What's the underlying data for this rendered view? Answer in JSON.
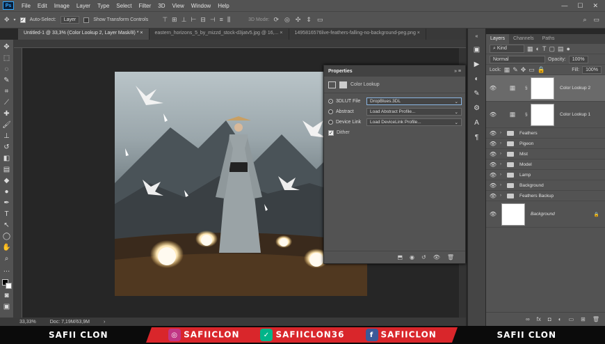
{
  "app": {
    "logo": "Ps"
  },
  "menu": [
    "File",
    "Edit",
    "Image",
    "Layer",
    "Type",
    "Select",
    "Filter",
    "3D",
    "View",
    "Window",
    "Help"
  ],
  "window_controls": {
    "minimize": "—",
    "maximize": "☐",
    "close": "✕"
  },
  "options_bar": {
    "auto_select_label": "Auto-Select:",
    "auto_select_value": "Layer",
    "transform_label": "Show Transform Controls",
    "mode_3d": "3D Mode:"
  },
  "tabs": [
    {
      "label": "Untitled-1 @ 33,3% (Color Lookup 2, Layer Mask/8) *",
      "close": "×"
    },
    {
      "label": "eastern_horizons_5_by_mizzd_stock-d3jatv5.jpg @ 16,...",
      "close": "×"
    },
    {
      "label": "1495816576live-feathers-falling-no-background-peg.png",
      "close": "×"
    }
  ],
  "status": {
    "zoom": "33,33%",
    "doc": "Doc: 7,19M/63,9M",
    "arrow": "›"
  },
  "properties": {
    "title": "Properties",
    "adjustment_name": "Color Lookup",
    "rows": [
      {
        "label": "3DLUT File",
        "value": "DropBlues.3DL"
      },
      {
        "label": "Abstract",
        "value": "Load Abstract Profile..."
      },
      {
        "label": "Device Link",
        "value": "Load DeviceLink Profile..."
      }
    ],
    "dither": "Dither"
  },
  "layers_panel": {
    "tabs": [
      "Layers",
      "Channels",
      "Paths"
    ],
    "filter": "Kind",
    "blend_mode": "Normal",
    "opacity_label": "Opacity:",
    "opacity": "100%",
    "lock_label": "Lock:",
    "fill_label": "Fill:",
    "fill": "100%",
    "adjustment_layers": [
      "Color Lookup 2",
      "Color Lookup 1"
    ],
    "groups": [
      "Feathers",
      "Pigeon",
      "Mist",
      "Model",
      "Lamp",
      "Background",
      "Feathers Backup"
    ],
    "background_layer": "Background"
  },
  "banner": {
    "left": "SAFII CLON",
    "instagram": "SAFIICLON",
    "vine": "SAFIICLON36",
    "facebook": "SAFIICLON",
    "right": "SAFII CLON"
  },
  "colors": {
    "accent": "#31a8ff",
    "banner_red": "#d9262b"
  }
}
